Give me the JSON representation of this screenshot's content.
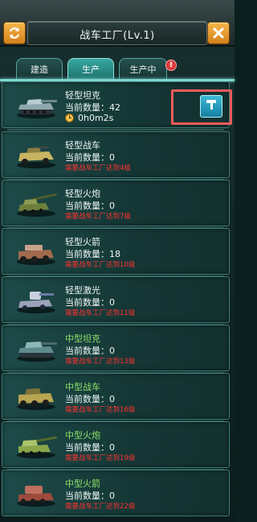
{
  "window": {
    "title": "战车工厂(Lv.1)"
  },
  "tabs": [
    {
      "label": "建造",
      "active": false
    },
    {
      "label": "生产",
      "active": true
    },
    {
      "label": "生产中",
      "active": false
    }
  ],
  "tab_badge": {
    "symbol": "!"
  },
  "icons": {
    "refresh": "refresh-icon",
    "close": "close-icon",
    "build": "hammer-icon",
    "timer": "clock-icon"
  },
  "colors": {
    "requirement": "#ff3030",
    "mid_name": "#8ee06a",
    "highlight": "#ef5a5a",
    "accent": "#37a8a0"
  },
  "units": [
    {
      "name": "轻型坦克",
      "qty": "当前数量：42",
      "timer": "0h0m2s",
      "req": ""
    },
    {
      "name": "轻型战车",
      "qty": "当前数量：0",
      "req": "需要战车工厂达到4级"
    },
    {
      "name": "轻型火炮",
      "qty": "当前数量：0",
      "req": "需要战车工厂达到7级"
    },
    {
      "name": "轻型火箭",
      "qty": "当前数量：18",
      "req": "需要战车工厂达到10级"
    },
    {
      "name": "轻型激光",
      "qty": "当前数量：0",
      "req": "需要战车工厂达到11级"
    },
    {
      "name": "中型坦克",
      "qty": "当前数量：0",
      "req": "需要战车工厂达到13级"
    },
    {
      "name": "中型战车",
      "qty": "当前数量：0",
      "req": "需要战车工厂达到16级"
    },
    {
      "name": "中型火炮",
      "qty": "当前数量：0",
      "req": "需要战车工厂达到19级"
    },
    {
      "name": "中型火箭",
      "qty": "当前数量：0",
      "req": "需要战车工厂达到22级"
    }
  ]
}
